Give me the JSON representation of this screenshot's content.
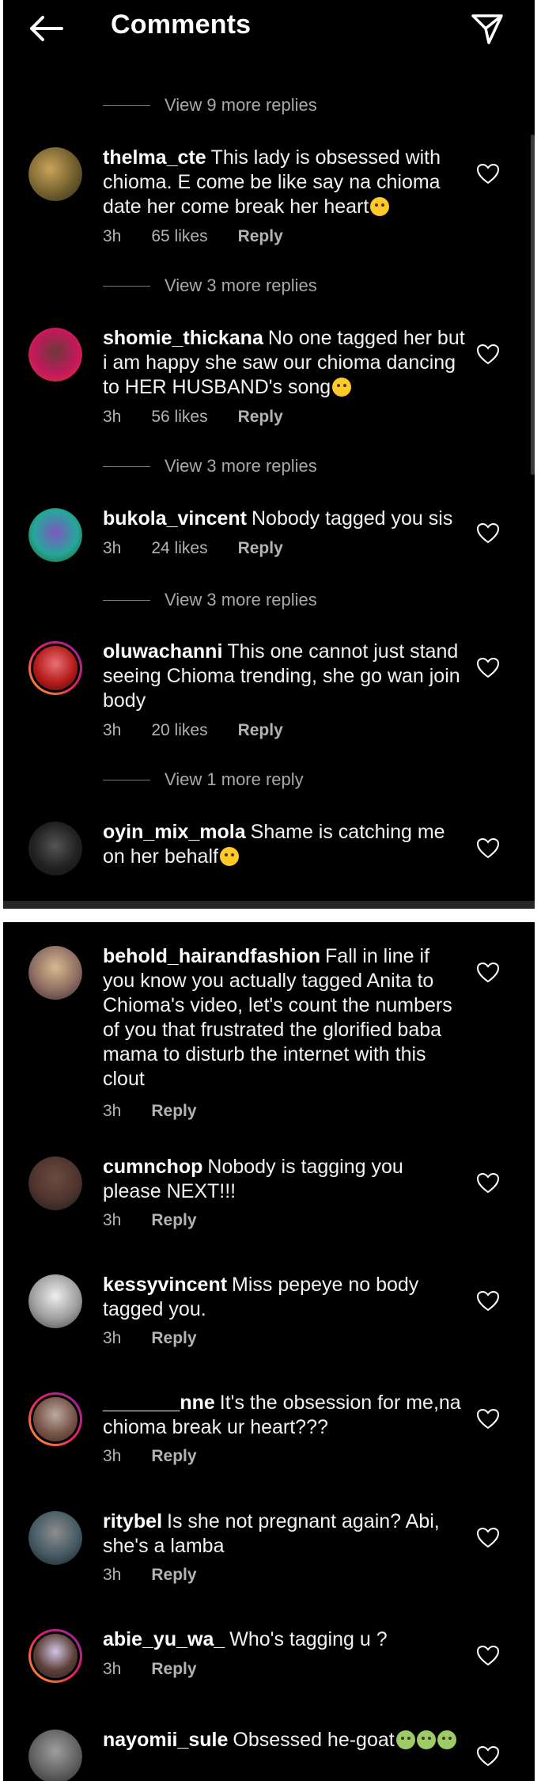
{
  "header": {
    "title": "Comments"
  },
  "view_more": {
    "vm1": "View 9 more replies",
    "vm2": "View 3 more replies",
    "vm3": "View 3 more replies",
    "vm4": "View 3 more replies",
    "vm5": "View 1 more reply"
  },
  "comments": [
    {
      "user": "thelma_cte",
      "text": "This lady is obsessed with chioma. E come be like say na chioma date her come break her heart",
      "time": "3h",
      "likes": "65 likes",
      "reply": "Reply"
    },
    {
      "user": "shomie_thickana",
      "text": "No one tagged her but i am happy she saw our chioma dancing to HER HUSBAND's song",
      "time": "3h",
      "likes": "56 likes",
      "reply": "Reply"
    },
    {
      "user": "bukola_vincent",
      "text": "Nobody tagged you sis",
      "time": "3h",
      "likes": "24 likes",
      "reply": "Reply"
    },
    {
      "user": "oluwachanni",
      "text": "This one cannot just stand seeing Chioma trending, she go wan join body",
      "time": "3h",
      "likes": "20 likes",
      "reply": "Reply"
    },
    {
      "user": "oyin_mix_mola",
      "text": "Shame is catching me on her behalf",
      "time": "",
      "likes": "",
      "reply": ""
    },
    {
      "user": "behold_hairandfashion",
      "text": "Fall in line if you know you actually tagged Anita to Chioma's video, let's count the numbers of you that frustrated the glorified baba mama to disturb the internet with this clout",
      "time": "3h",
      "likes": "",
      "reply": "Reply"
    },
    {
      "user": "cumnchop",
      "text": "Nobody is tagging you please NEXT!!!",
      "time": "3h",
      "likes": "",
      "reply": "Reply"
    },
    {
      "user": "kessyvincent",
      "text": "Miss pepeye no body tagged you.",
      "time": "3h",
      "likes": "",
      "reply": "Reply"
    },
    {
      "user": "_______nne",
      "text": "It's the obsession for me,na chioma break ur heart???",
      "time": "3h",
      "likes": "",
      "reply": "Reply"
    },
    {
      "user": "ritybel",
      "text": "Is she not pregnant again? Abi, she's a lamba",
      "time": "3h",
      "likes": "",
      "reply": "Reply"
    },
    {
      "user": "abie_yu_wa_",
      "text": "Who's tagging u ?",
      "time": "3h",
      "likes": "",
      "reply": "Reply"
    },
    {
      "user": "nayomii_sule",
      "text": "Obsessed he-goat",
      "time": "",
      "likes": "",
      "reply": ""
    }
  ],
  "icons": {
    "back": "back-arrow-icon",
    "send": "send-icon",
    "heart": "heart-icon",
    "laughing": "laughing-emoji-icon",
    "crying": "crying-emoji-icon",
    "vomiting": "vomiting-emoji-icon"
  },
  "colors": {
    "background": "#000000",
    "text": "#ffffff",
    "secondary": "#a8a8a8",
    "story_ring": "#e91e63"
  }
}
